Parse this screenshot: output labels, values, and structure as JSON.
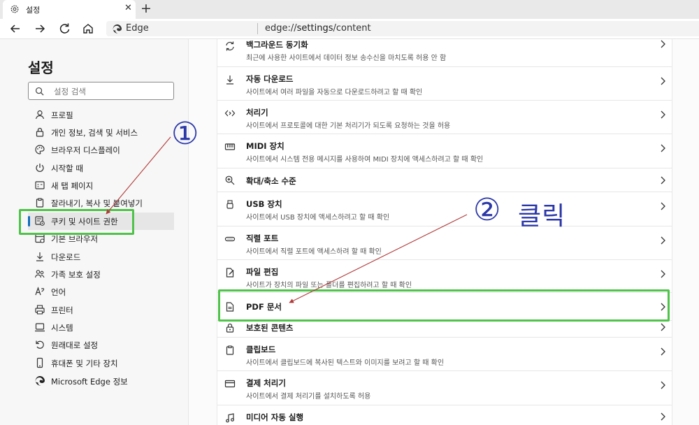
{
  "tab": {
    "title": "설정",
    "new_tab": "+"
  },
  "address": {
    "brand": "Edge",
    "url_prefix": "edge://",
    "url_path": "settings",
    "url_suffix": "/content"
  },
  "sidebar": {
    "title": "설정",
    "search_placeholder": "설정 검색",
    "items": [
      {
        "label": "프로필",
        "icon": "profile-icon"
      },
      {
        "label": "개인 정보, 검색 및 서비스",
        "icon": "lock-icon"
      },
      {
        "label": "브라우저 디스플레이",
        "icon": "palette-icon"
      },
      {
        "label": "시작할 때",
        "icon": "power-icon"
      },
      {
        "label": "새 탭 페이지",
        "icon": "newtab-icon"
      },
      {
        "label": "잘라내기, 복사 및 붙여넣기",
        "icon": "clipboard-icon"
      },
      {
        "label": "쿠키 및 사이트 권한",
        "icon": "site-permissions-icon",
        "active": true
      },
      {
        "label": "기본 브라우저",
        "icon": "browser-icon"
      },
      {
        "label": "다운로드",
        "icon": "download-icon"
      },
      {
        "label": "가족 보호 설정",
        "icon": "family-icon"
      },
      {
        "label": "언어",
        "icon": "language-icon"
      },
      {
        "label": "프린터",
        "icon": "printer-icon"
      },
      {
        "label": "시스템",
        "icon": "system-icon"
      },
      {
        "label": "원래대로 설정",
        "icon": "reset-icon"
      },
      {
        "label": "휴대폰 및 기타 장치",
        "icon": "phone-icon"
      },
      {
        "label": "Microsoft Edge 정보",
        "icon": "edge-logo-icon"
      }
    ]
  },
  "content": {
    "rows": [
      {
        "title": "백그라운드 동기화",
        "desc": "최근에 사용한 사이트에서 데이터 정보 송수신을 마치도록 허용 안 함",
        "icon": "sync-icon"
      },
      {
        "title": "자동 다운로드",
        "desc": "사이트에서 여러 파일을 자동으로 다운로드하려고 할 때 확인",
        "icon": "download-icon"
      },
      {
        "title": "처리기",
        "desc": "사이트에서 프로토콜에 대한 기본 처리기가 되도록 요청하는 것을 허용",
        "icon": "handler-icon"
      },
      {
        "title": "MIDI 장치",
        "desc": "사이트에서 시스템 전용 메시지를 사용하여 MIDI 장치에 액세스하려고 할 때 확인",
        "icon": "midi-icon"
      },
      {
        "title": "확대/축소 수준",
        "desc": "",
        "icon": "zoom-icon"
      },
      {
        "title": "USB 장치",
        "desc": "사이트에서 USB 장치에 액세스하려고 할 때 확인",
        "icon": "usb-icon"
      },
      {
        "title": "직렬 포트",
        "desc": "사이트에서 직렬 포트에 액세스하려 할 때 확인",
        "icon": "serial-port-icon"
      },
      {
        "title": "파일 편집",
        "desc": "사이트가 장치의 파일 또는 폴더를 편집하려고 할 때 확인",
        "icon": "file-edit-icon"
      },
      {
        "title": "PDF 문서",
        "desc": "",
        "icon": "pdf-icon"
      },
      {
        "title": "보호된 콘텐츠",
        "desc": "",
        "icon": "protected-content-icon"
      },
      {
        "title": "클립보드",
        "desc": "사이트에서 클립보드에 복사된 텍스트와 이미지를 보려고 할 때 확인",
        "icon": "clipboard-icon"
      },
      {
        "title": "결제 처리기",
        "desc": "사이트에서 결제 처리기를 설치하도록 허용",
        "icon": "payment-icon"
      },
      {
        "title": "미디어 자동 실행",
        "desc": "",
        "icon": "media-icon"
      }
    ]
  },
  "annotations": {
    "step1": "①",
    "step2": "②",
    "click_label": "클릭",
    "highlight_color": "#4fc34a",
    "arrow_color": "#b23a3a",
    "text_color": "#2c38a8"
  },
  "colors": {
    "accent": "#0f6cbd"
  }
}
